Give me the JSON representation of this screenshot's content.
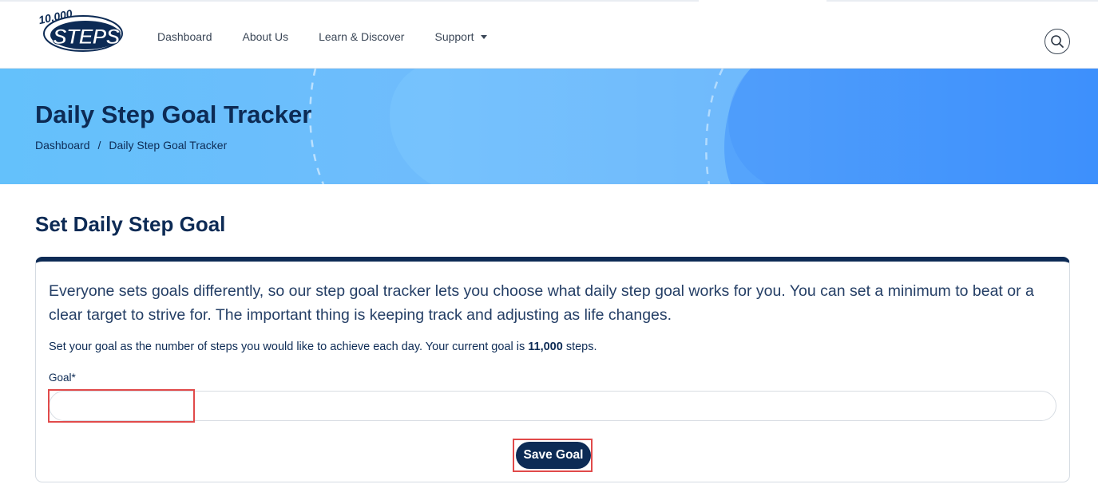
{
  "logo": {
    "top_text": "10,000",
    "main_text": "STEPS"
  },
  "nav": {
    "items": [
      {
        "label": "Dashboard"
      },
      {
        "label": "About Us"
      },
      {
        "label": "Learn & Discover"
      },
      {
        "label": "Support"
      }
    ]
  },
  "hero": {
    "title": "Daily Step Goal Tracker",
    "breadcrumb": [
      "Dashboard",
      "Daily Step Goal Tracker"
    ],
    "separator": "/"
  },
  "section": {
    "title": "Set Daily Step Goal"
  },
  "card": {
    "intro": "Everyone sets goals differently, so our step goal tracker lets you choose what daily step goal works for you. You can set a minimum to beat or a clear target to strive for. The important thing is keeping track and adjusting as life changes.",
    "goal_text_prefix": "Set your goal as the number of steps you would like to achieve each day. Your current goal is",
    "current_goal": "11,000",
    "goal_text_suffix": "steps.",
    "goal_label": "Goal*",
    "goal_value": "",
    "save_label": "Save Goal"
  },
  "colors": {
    "navy": "#0d2b55",
    "hero_start": "#64c1fb",
    "hero_end": "#3a8efc",
    "highlight": "#e14a4a"
  }
}
